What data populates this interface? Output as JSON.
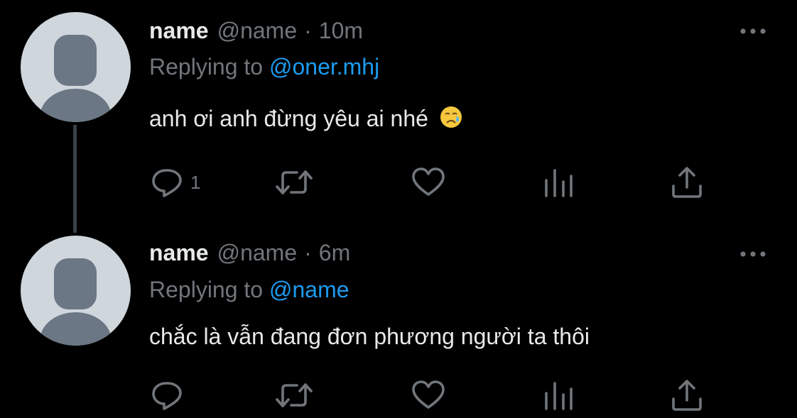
{
  "tweets": [
    {
      "name": "name",
      "handle": "@name",
      "separator": "·",
      "time": "10m",
      "replying_prefix": "Replying to",
      "replying_to": "@oner.mhj",
      "text": "anh ơi anh đừng yêu ai nhé",
      "emoji": "crying-face-emoji",
      "reply_count": "1"
    },
    {
      "name": "name",
      "handle": "@name",
      "separator": "·",
      "time": "6m",
      "replying_prefix": "Replying to",
      "replying_to": "@name",
      "text": "chắc là vẫn đang đơn phương người ta thôi"
    }
  ],
  "colors": {
    "background": "#000000",
    "primary_text": "#e7e9ea",
    "secondary_text": "#71767b",
    "link": "#1d9bf0",
    "avatar_bg": "#cfd6dc",
    "avatar_fg": "#6b7784",
    "thread_line": "#3b4148"
  },
  "icons": [
    "reply-icon",
    "retweet-icon",
    "like-icon",
    "views-icon",
    "share-icon",
    "more-icon"
  ]
}
